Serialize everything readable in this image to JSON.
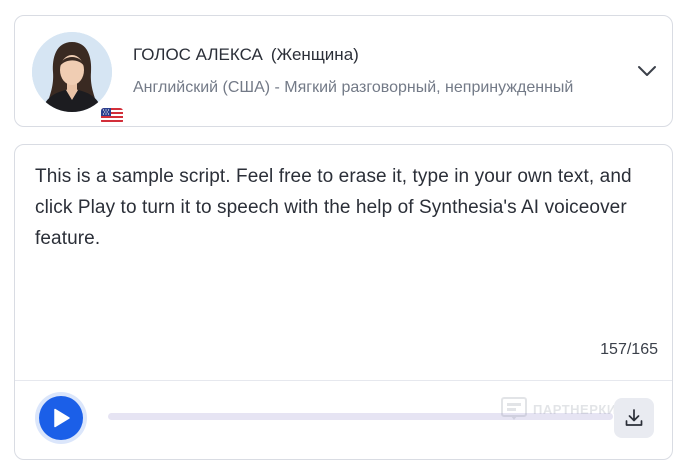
{
  "voice": {
    "name": "ГОЛОС АЛЕКСА",
    "gender": "(Женщина)",
    "description": "Английский (США) - Мягкий разговорный, непринужденный",
    "flag_icon": "us-flag-icon",
    "avatar_icon": "woman-avatar",
    "expand_icon": "chevron-down-icon"
  },
  "script": {
    "text": "This is a sample script. Feel free to erase it, type in your own text, and click Play to turn it to speech with the help of Synthesia's AI voiceover feature.",
    "char_count": "157/165"
  },
  "player": {
    "play_icon": "play-icon",
    "progress": 0,
    "download_icon": "download-icon",
    "watermark_text": "ПАРТНЕРКИН"
  },
  "colors": {
    "accent": "#1b5fe8",
    "border": "#d9dce3",
    "text": "#2b2f38",
    "muted": "#737a87",
    "track": "#e6e4f3"
  }
}
